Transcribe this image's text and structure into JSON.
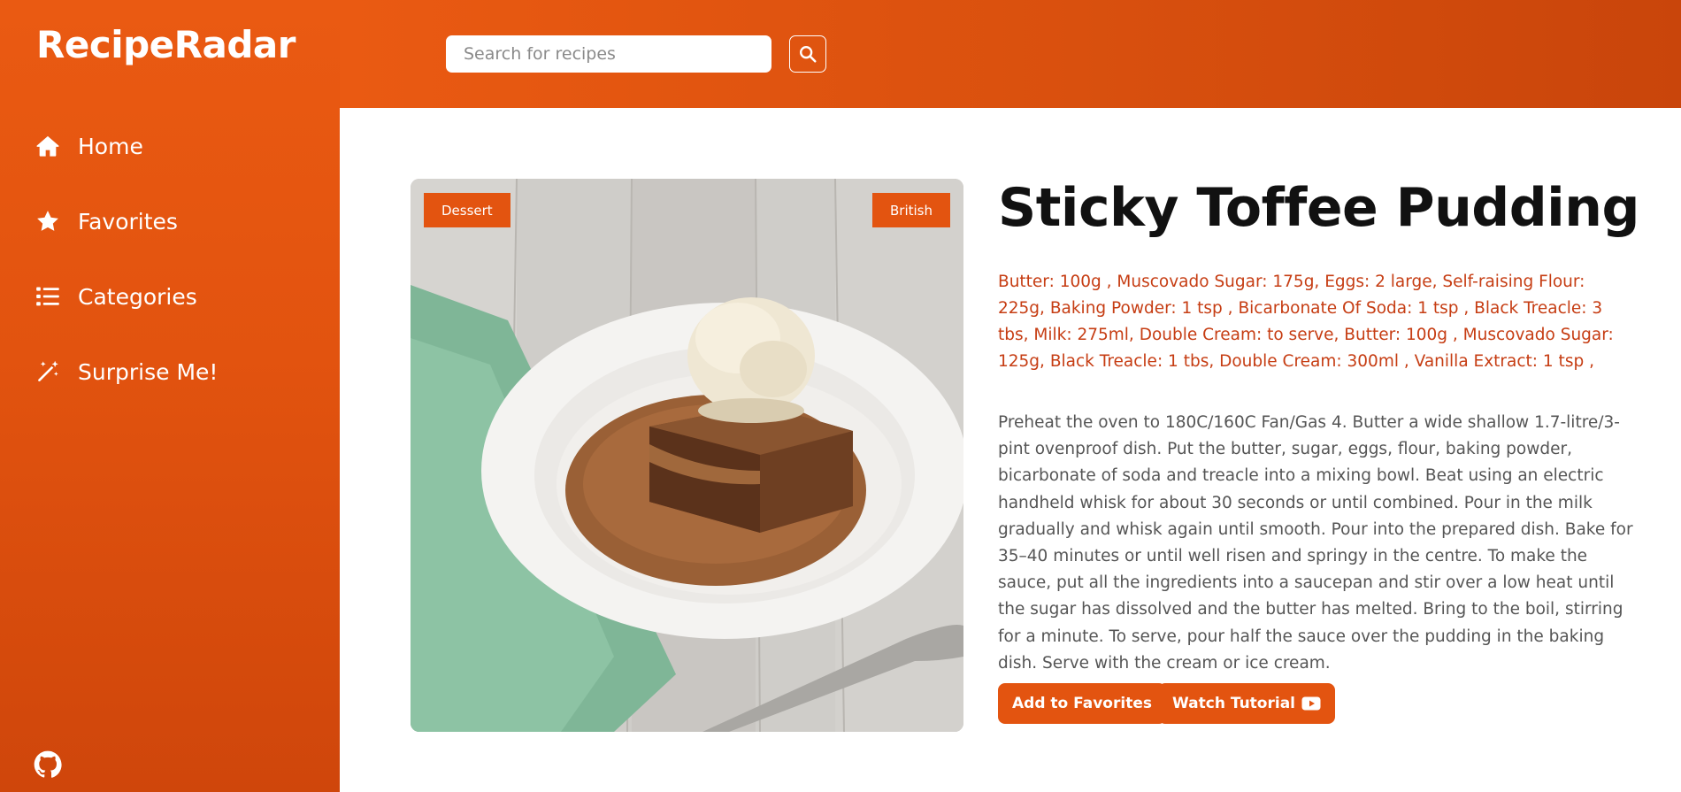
{
  "app": {
    "name": "RecipeRadar"
  },
  "sidebar": {
    "items": [
      {
        "label": "Home",
        "icon": "home-icon"
      },
      {
        "label": "Favorites",
        "icon": "star-icon"
      },
      {
        "label": "Categories",
        "icon": "list-icon"
      },
      {
        "label": "Surprise Me!",
        "icon": "magic-wand-icon"
      }
    ],
    "footer_icon": "github-icon"
  },
  "search": {
    "placeholder": "Search for recipes",
    "value": "",
    "button_icon": "search-icon"
  },
  "recipe": {
    "title": "Sticky Toffee Pudding",
    "category": "Dessert",
    "area": "British",
    "ingredients": "Butter: 100g , Muscovado Sugar: 175g, Eggs: 2 large, Self-raising Flour: 225g, Baking Powder: 1 tsp , Bicarbonate Of Soda: 1 tsp , Black Treacle: 3 tbs, Milk: 275ml, Double Cream: to serve, Butter: 100g , Muscovado Sugar: 125g, Black Treacle: 1 tbs, Double Cream: 300ml , Vanilla Extract: 1 tsp ,",
    "instructions": "Preheat the oven to 180C/160C Fan/Gas 4. Butter a wide shallow 1.7-litre/3-pint ovenproof dish. Put the butter, sugar, eggs, flour, baking powder, bicarbonate of soda and treacle into a mixing bowl. Beat using an electric handheld whisk for about 30 seconds or until combined. Pour in the milk gradually and whisk again until smooth. Pour into the prepared dish. Bake for 35–40 minutes or until well risen and springy in the centre. To make the sauce, put all the ingredients into a saucepan and stir over a low heat until the sugar has dissolved and the butter has melted. Bring to the boil, stirring for a minute. To serve, pour half the sauce over the pudding in the baking dish. Serve with the cream or ice cream."
  },
  "actions": {
    "favorite_label": "Add to Favorites",
    "tutorial_label": "Watch Tutorial",
    "tutorial_icon": "youtube-icon"
  },
  "colors": {
    "accent": "#e35410",
    "ingredients_text": "#c63d13",
    "body_text": "#555555"
  }
}
